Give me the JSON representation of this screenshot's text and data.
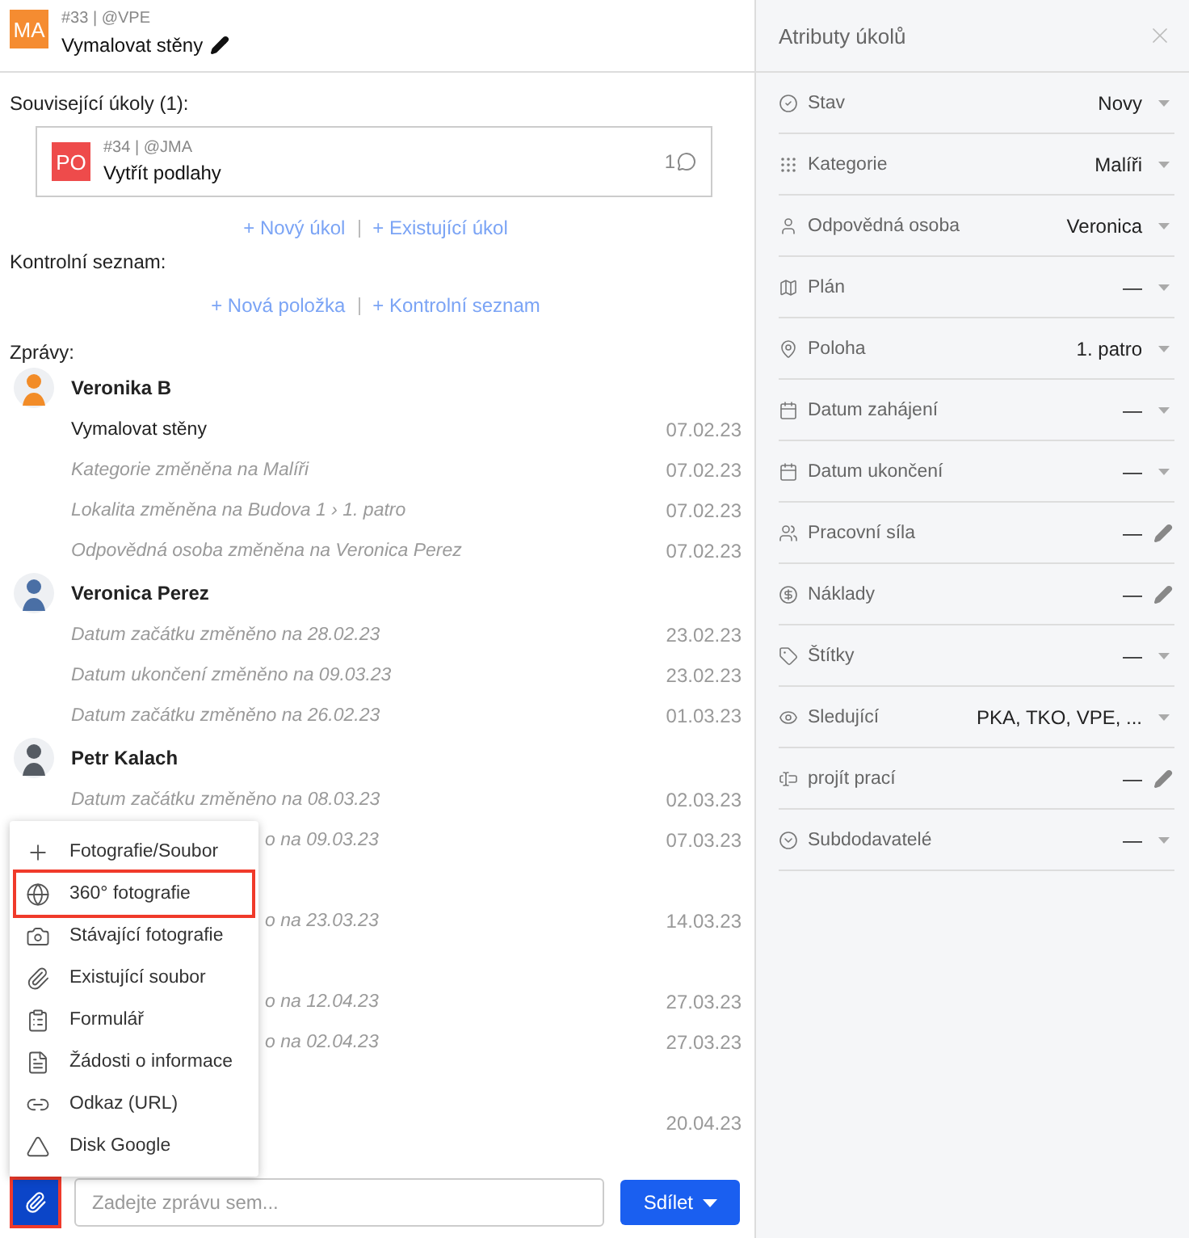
{
  "task": {
    "avatar": "MA",
    "meta": "#33 | @VPE",
    "title": "Vymalovat stěny"
  },
  "related": {
    "heading": "Související úkoly (1):",
    "tasks": [
      {
        "avatar": "PO",
        "meta": "#34 | @JMA",
        "title": "Vytřít podlahy",
        "comments": "1"
      }
    ],
    "links": [
      "+ Nový úkol",
      "+ Existující úkol"
    ]
  },
  "checklist": {
    "heading": "Kontrolní seznam:",
    "links": [
      "+ Nová položka",
      "+ Kontrolní seznam"
    ]
  },
  "messages_heading": "Zprávy:",
  "messages": [
    {
      "kind": "author",
      "name": "Veronika B",
      "color": "#f28c28"
    },
    {
      "kind": "text",
      "text": "Vymalovat stěny",
      "date": "07.02.23"
    },
    {
      "kind": "event",
      "text": "Kategorie změněna na Malíři",
      "date": "07.02.23"
    },
    {
      "kind": "event",
      "text": "Lokalita změněna na Budova 1 › 1. patro",
      "date": "07.02.23"
    },
    {
      "kind": "event",
      "text": "Odpovědná osoba změněna na Veronica Perez",
      "date": "07.02.23"
    },
    {
      "kind": "author",
      "name": "Veronica Perez",
      "color": "#4a6fa5"
    },
    {
      "kind": "event",
      "text": "Datum začátku změněno na 28.02.23",
      "date": "23.02.23"
    },
    {
      "kind": "event",
      "text": "Datum ukončení změněno na 09.03.23",
      "date": "23.02.23"
    },
    {
      "kind": "event",
      "text": "Datum začátku změněno na 26.02.23",
      "date": "01.03.23"
    },
    {
      "kind": "author",
      "name": "Petr Kalach",
      "color": "#555b63"
    },
    {
      "kind": "event",
      "text": "Datum začátku změněno na 08.03.23",
      "date": "02.03.23"
    },
    {
      "kind": "event",
      "text": "o na 09.03.23",
      "date": "07.03.23",
      "covered": true
    },
    {
      "kind": "blank"
    },
    {
      "kind": "event",
      "text": "o na 23.03.23",
      "date": "14.03.23",
      "covered": true
    },
    {
      "kind": "blank"
    },
    {
      "kind": "event",
      "text": "o na 12.04.23",
      "date": "27.03.23",
      "covered": true
    },
    {
      "kind": "event",
      "text": "o na 02.04.23",
      "date": "27.03.23",
      "covered": true
    },
    {
      "kind": "blank"
    },
    {
      "kind": "event",
      "date": "20.04.23",
      "covered": true
    }
  ],
  "attach_menu": [
    {
      "label": "Fotografie/Soubor",
      "highlighted": false
    },
    {
      "label": "360° fotografie",
      "highlighted": true
    },
    {
      "label": "Stávající fotografie",
      "highlighted": false
    },
    {
      "label": "Existující soubor",
      "highlighted": false
    },
    {
      "label": "Formulář",
      "highlighted": false
    },
    {
      "label": "Žádosti o informace",
      "highlighted": false
    },
    {
      "label": "Odkaz (URL)",
      "highlighted": false
    },
    {
      "label": "Disk Google",
      "highlighted": false
    }
  ],
  "composer": {
    "attach_highlighted": true,
    "placeholder": "Zadejte zprávu sem...",
    "send": "Sdílet"
  },
  "attributes": {
    "title": "Atributy úkolů",
    "rows": [
      {
        "label": "Stav",
        "value": "Novy",
        "kind": "select"
      },
      {
        "label": "Kategorie",
        "value": "Malíři",
        "kind": "select"
      },
      {
        "label": "Odpovědná osoba",
        "value": "Veronica",
        "kind": "select"
      },
      {
        "label": "Plán",
        "value": "—",
        "kind": "select"
      },
      {
        "label": "Poloha",
        "value": "1. patro",
        "kind": "select"
      },
      {
        "label": "Datum zahájení",
        "value": "—",
        "kind": "select"
      },
      {
        "label": "Datum ukončení",
        "value": "—",
        "kind": "select"
      },
      {
        "label": "Pracovní síla",
        "value": "—",
        "kind": "edit"
      },
      {
        "label": "Náklady",
        "value": "—",
        "kind": "edit"
      },
      {
        "label": "Štítky",
        "value": "—",
        "kind": "select"
      },
      {
        "label": "Sledující",
        "value": "PKA, TKO, VPE, ...",
        "kind": "select"
      },
      {
        "label": "projít prací",
        "value": "—",
        "kind": "edit"
      },
      {
        "label": "Subdodavatelé",
        "value": "—",
        "kind": "select"
      }
    ]
  }
}
